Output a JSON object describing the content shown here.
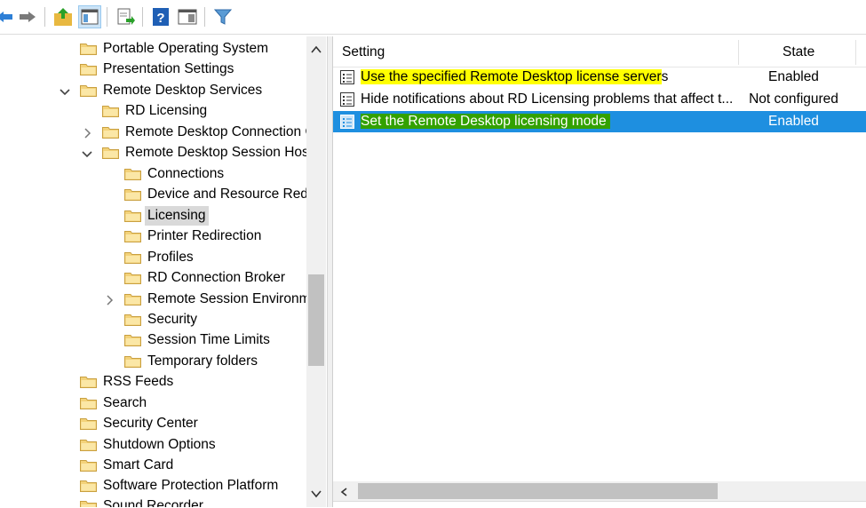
{
  "toolbar": {
    "buttons": [
      {
        "icon": "back-arrow-icon"
      },
      {
        "icon": "forward-arrow-icon"
      },
      {
        "icon": "up-folder-icon"
      },
      {
        "icon": "show-hide-console-tree-icon"
      },
      {
        "icon": "export-list-icon"
      },
      {
        "icon": "help-icon"
      },
      {
        "icon": "show-hide-action-pane-icon"
      },
      {
        "icon": "filter-icon"
      }
    ]
  },
  "tree": {
    "items": [
      {
        "label": "Portable Operating System"
      },
      {
        "label": "Presentation Settings"
      },
      {
        "label": "Remote Desktop Services",
        "expander": "expanded"
      },
      {
        "label": "RD Licensing"
      },
      {
        "label": "Remote Desktop Connection C",
        "expander": "collapsed"
      },
      {
        "label": "Remote Desktop Session Host",
        "expander": "expanded"
      },
      {
        "label": "Connections"
      },
      {
        "label": "Device and Resource Redir"
      },
      {
        "label": "Licensing",
        "selected": true
      },
      {
        "label": "Printer Redirection"
      },
      {
        "label": "Profiles"
      },
      {
        "label": "RD Connection Broker"
      },
      {
        "label": "Remote Session Environm",
        "expander": "collapsed"
      },
      {
        "label": "Security"
      },
      {
        "label": "Session Time Limits"
      },
      {
        "label": "Temporary folders"
      },
      {
        "label": "RSS Feeds"
      },
      {
        "label": "Search"
      },
      {
        "label": "Security Center"
      },
      {
        "label": "Shutdown Options"
      },
      {
        "label": "Smart Card"
      },
      {
        "label": "Software Protection Platform"
      },
      {
        "label": "Sound Recorder"
      }
    ]
  },
  "list": {
    "columns": {
      "setting": "Setting",
      "state": "State"
    },
    "rows": [
      {
        "setting_highlighted": "Use the specified Remote Desktop license server",
        "setting_rest": "s",
        "state": "Enabled",
        "highlight": "yellow"
      },
      {
        "setting_highlighted": "",
        "setting_rest": "Hide notifications about RD Licensing problems that affect t...",
        "state": "Not configured",
        "highlight": "none"
      },
      {
        "setting_highlighted": "Set the Remote Desktop licensing mode",
        "setting_rest": "",
        "state": "Enabled",
        "highlight": "green",
        "selected": true
      }
    ]
  },
  "colors": {
    "selection_blue": "#1e8fe0",
    "highlight_yellow": "#ffff00",
    "highlight_green": "#33a100",
    "folder_yellow": "#f3d27a"
  }
}
